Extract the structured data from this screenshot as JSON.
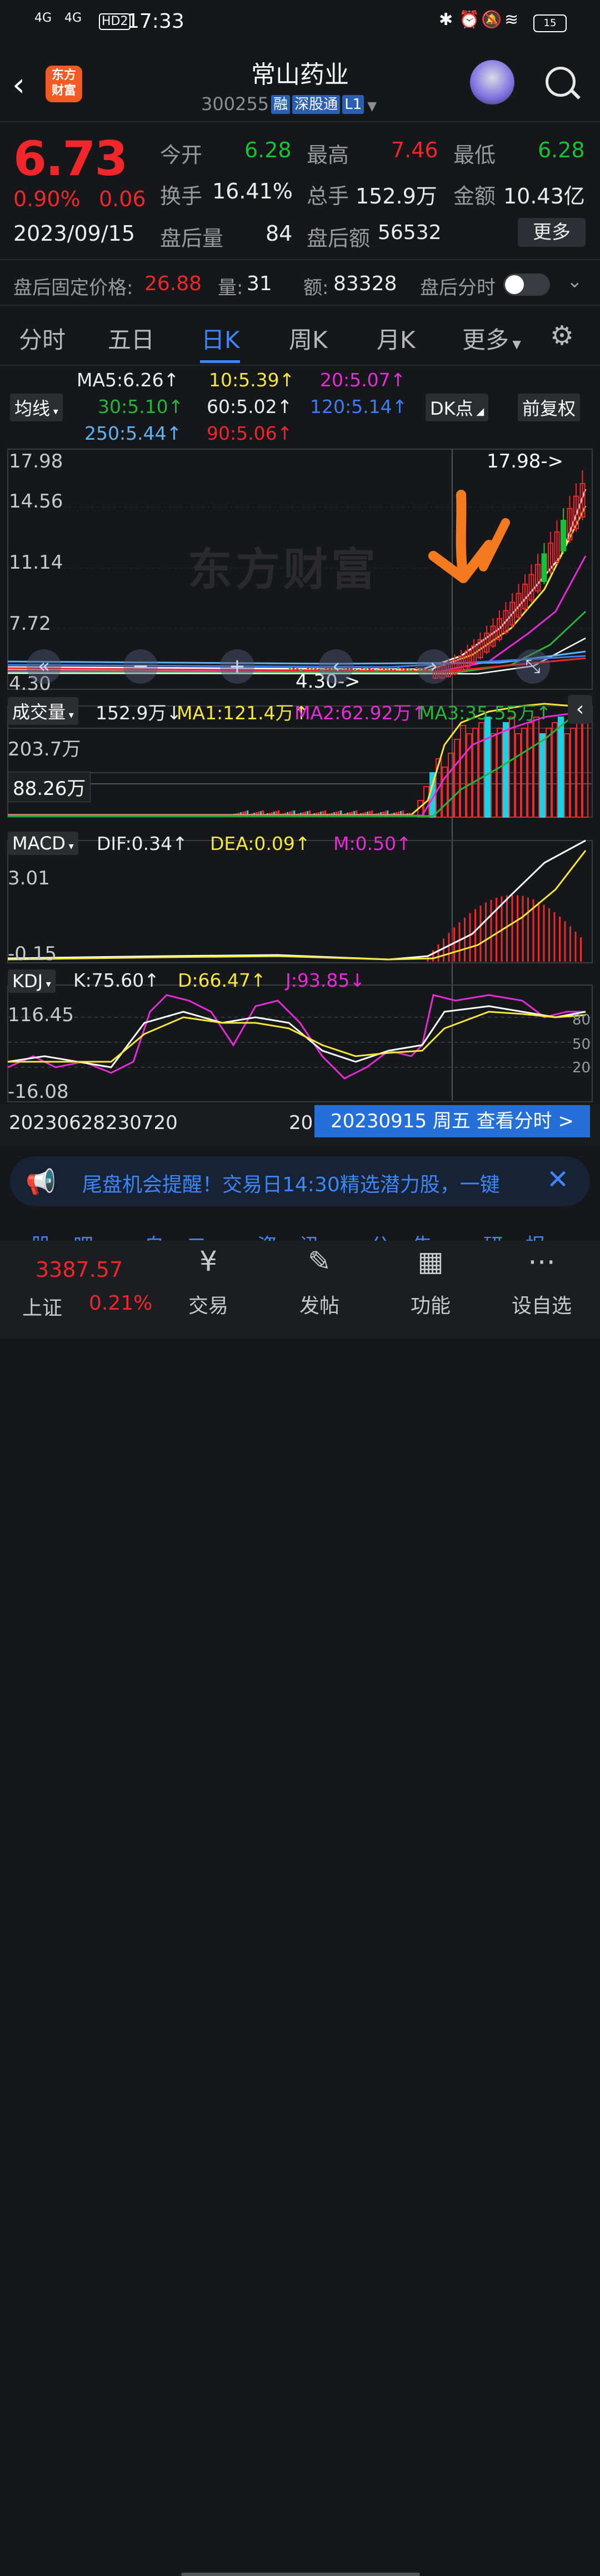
{
  "status": {
    "sig1": "4G",
    "sig2": "4G",
    "hd": "HD2",
    "time": "17:33",
    "battery": "15"
  },
  "header": {
    "logo_line1": "东方",
    "logo_line2": "财富",
    "title": "常山药业",
    "code": "300255",
    "tags": [
      "融",
      "深股通",
      "L1"
    ]
  },
  "quote": {
    "price": "6.73",
    "change_pct": "0.90%",
    "change": "0.06",
    "date": "2023/09/15",
    "open_label": "今开",
    "open": "6.28",
    "high_label": "最高",
    "high": "7.46",
    "low_label": "最低",
    "low": "6.28",
    "turnover_label": "换手",
    "turnover": "16.41%",
    "volume_label": "总手",
    "volume": "152.9万",
    "amount_label": "金额",
    "amount": "10.43亿",
    "ah_vol_label": "盘后量",
    "ah_vol": "84",
    "ah_amt_label": "盘后额",
    "ah_amt": "56532",
    "more_button": "更多",
    "fixed_price_label": "盘后固定价格:",
    "fixed_price": "26.88",
    "fixed_qty_label": "量:",
    "fixed_qty": "31",
    "fixed_amt_label": "额:",
    "fixed_amt": "83328",
    "ah_timeshare_label": "盘后分时"
  },
  "tabs": [
    "分时",
    "五日",
    "日K",
    "周K",
    "月K",
    "更多"
  ],
  "active_tab": "日K",
  "ma": {
    "button": "均线",
    "ma5": "MA5:6.26↑",
    "ma10": "10:5.39↑",
    "ma20": "20:5.07↑",
    "ma30": "30:5.10↑",
    "ma60": "60:5.02↑",
    "ma120": "120:5.14↑",
    "ma250": "250:5.44↑",
    "ma90": "90:5.06↑",
    "dk_button": "DK点",
    "adjust_button": "前复权"
  },
  "kline": {
    "y_labels": [
      "17.98",
      "14.56",
      "11.14",
      "7.72",
      "4.30"
    ],
    "max_marker": "17.98->",
    "min_marker": "4.30->",
    "watermark": "东方财富"
  },
  "volume": {
    "button": "成交量",
    "vol": "152.9万↓",
    "ma1": "MA1:121.4万↑",
    "ma2": "MA2:62.92万↑",
    "ma3": "MA3:35.55万↑",
    "y_top": "203.7万",
    "cursor_value": "88.26万"
  },
  "macd": {
    "button": "MACD",
    "dif": "DIF:0.34↑",
    "dea": "DEA:0.09↑",
    "m": "M:0.50↑",
    "y_top": "3.01",
    "y_bottom": "-0.15"
  },
  "kdj": {
    "button": "KDJ",
    "k": "K:75.60↑",
    "d": "D:66.47↑",
    "j": "J:93.85↓",
    "y_top": "116.45",
    "y_bottom": "-16.08",
    "right_80": "80",
    "right_50": "50",
    "right_20": "20"
  },
  "dates": {
    "d1": "20230628",
    "d2": "230720",
    "d3": "20",
    "cursor_date": "20230915 周五 查看分时 >"
  },
  "banner": {
    "text": "尾盘机会提醒！交易日14:30精选潜力股，一键"
  },
  "bottom": {
    "index_value": "3387.57",
    "index_name": "上证",
    "index_change": "0.21%",
    "nav": [
      "交易",
      "发帖",
      "功能",
      "设自选"
    ],
    "hidden_tabs": "股吧 自二 资讯 公告 研报 财务 资料"
  },
  "colors": {
    "up": "#f0262b",
    "down": "#19c137",
    "accent": "#3d86f6",
    "annotation": "#f47a1f"
  }
}
